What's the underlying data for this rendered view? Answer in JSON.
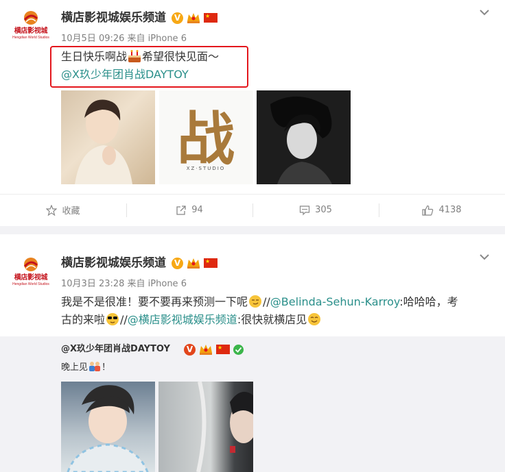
{
  "posts": [
    {
      "logo": {
        "cn": "横店影视城",
        "en": "Hengdian World Studios"
      },
      "author": "横店影视城娱乐频道",
      "meta": "10月5日 09:26 来自 iPhone 6",
      "text_line1": "生日快乐啊战",
      "text_line1b": "希望很快见面～",
      "mention": "@X玖少年团肖战DAYTOY",
      "images": [
        "photo-portrait-sweater",
        "xz-studio-logo",
        "photo-bw-portrait"
      ],
      "studio_glyph": "战",
      "studio_caption": "XZ·STUDIO"
    },
    {
      "logo": {
        "cn": "横店影视城",
        "en": "Hengdian World Studios"
      },
      "author": "横店影视城娱乐频道",
      "meta": "10月3日 23:28 来自 iPhone 6",
      "text_a": "我是不是很准！要不要再来预测一下呢",
      "text_b": "//",
      "mention1": "@Belinda-Sehun-Karroy",
      "text_c": ":哈哈哈，考",
      "text_d": "古的来啦",
      "text_e": "//",
      "mention2": "@横店影视城娱乐频道",
      "text_f": ":很快就横店见",
      "repost": {
        "author": "@X玖少年团肖战DAYTOY",
        "text": "晚上见",
        "text_end": "！"
      }
    }
  ],
  "actions": [
    {
      "icon": "star-icon",
      "label": "收藏"
    },
    {
      "icon": "share-icon",
      "label": "94"
    },
    {
      "icon": "comment-icon",
      "label": "305"
    },
    {
      "icon": "like-icon",
      "label": "4138"
    }
  ],
  "colors": {
    "mention": "#2a8f8a",
    "highlight_box": "#e3161c",
    "badge": "#f7a815"
  }
}
